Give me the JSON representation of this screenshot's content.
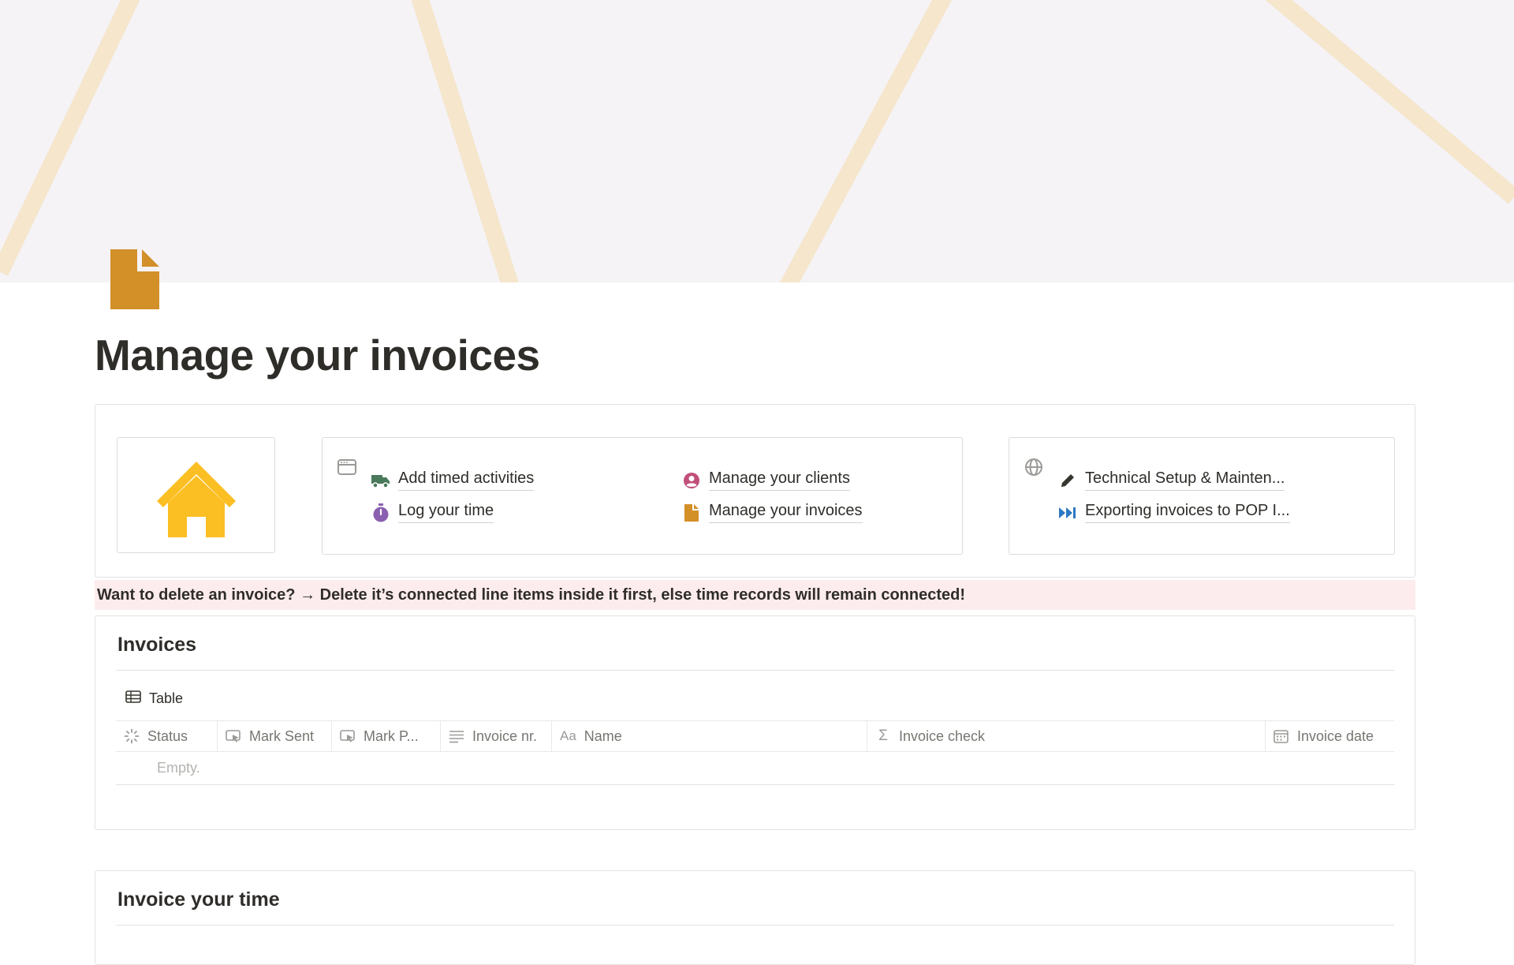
{
  "page": {
    "title": "Manage your invoices",
    "icon": "document-icon"
  },
  "colors": {
    "cover_background": "#f5f3f6",
    "cover_lines": "#f5e6cc",
    "page_icon": "#d38f28",
    "home_icon": "#fbbf24",
    "callout_background": "#fdeced"
  },
  "navigation": {
    "home_icon": "house-icon",
    "links_card_icon": "browser-window-icon",
    "links": [
      {
        "label": "Add timed activities",
        "icon": "truck-icon",
        "color": "#4a7a5c"
      },
      {
        "label": "Manage your clients",
        "icon": "user-circle-icon",
        "color": "#c14f7a"
      },
      {
        "label": "Log your time",
        "icon": "stopwatch-icon",
        "color": "#8a5fb0"
      },
      {
        "label": "Manage your invoices",
        "icon": "document-icon",
        "color": "#d38f28"
      }
    ],
    "tech_card_icon": "globe-icon",
    "tech_links": [
      {
        "label": "Technical Setup & Mainten...",
        "icon": "pencil-icon",
        "color": "#37352f"
      },
      {
        "label": "Exporting invoices to POP I...",
        "icon": "fast-forward-icon",
        "color": "#2b79c2"
      }
    ]
  },
  "callout": {
    "text": "Want to delete an invoice? → Delete it’s connected line items inside it first, else time records will remain connected!"
  },
  "invoices_db": {
    "title": "Invoices",
    "view_label": "Table",
    "columns": [
      {
        "label": "Status",
        "icon": "status-icon"
      },
      {
        "label": "Mark Sent",
        "icon": "button-icon"
      },
      {
        "label": "Mark P...",
        "icon": "button-icon"
      },
      {
        "label": "Invoice nr.",
        "icon": "text-lines-icon"
      },
      {
        "label": "Name",
        "icon": "title-aa-icon"
      },
      {
        "label": "Invoice check",
        "icon": "sigma-icon"
      },
      {
        "label": "Invoice date",
        "icon": "calendar-icon"
      }
    ],
    "empty_text": "Empty."
  },
  "time_db": {
    "title": "Invoice your time"
  }
}
